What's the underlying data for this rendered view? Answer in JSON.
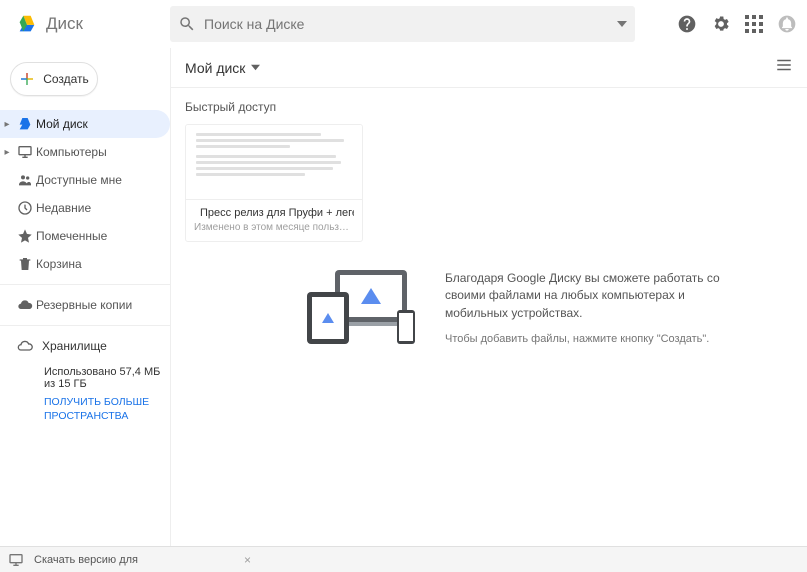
{
  "app": {
    "name": "Диск"
  },
  "search": {
    "placeholder": "Поиск на Диске"
  },
  "create": {
    "label": "Создать"
  },
  "nav": {
    "items": [
      {
        "label": "Мой диск"
      },
      {
        "label": "Компьютеры"
      },
      {
        "label": "Доступные мне"
      },
      {
        "label": "Недавние"
      },
      {
        "label": "Помеченные"
      },
      {
        "label": "Корзина"
      }
    ],
    "backup": {
      "label": "Резервные копии"
    },
    "storage": {
      "title": "Хранилище",
      "usage": "Использовано 57,4 МБ из 15 ГБ",
      "more1": "ПОЛУЧИТЬ БОЛЬШЕ",
      "more2": "ПРОСТРАНСТВА"
    }
  },
  "toolbar": {
    "breadcrumb": "Мой диск"
  },
  "quick": {
    "title": "Быстрый доступ"
  },
  "card": {
    "title": "Пресс релиз для Пруфи + легенда ...",
    "subtitle": "Изменено в этом месяце пользователем ..."
  },
  "empty": {
    "line1": "Благодаря Google Диску вы сможете работать со своими файлами на любых компьютерах и мобильных устройствах.",
    "line2": "Чтобы добавить файлы, нажмите кнопку \"Создать\"."
  },
  "bottom": {
    "text": "Скачать версию для"
  }
}
